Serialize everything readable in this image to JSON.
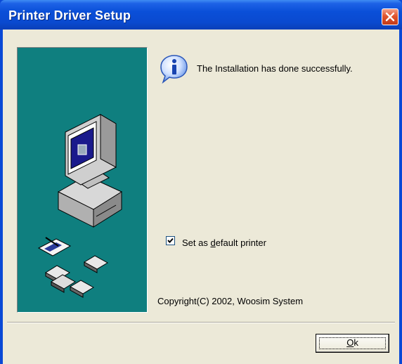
{
  "window": {
    "title": "Printer Driver Setup"
  },
  "content": {
    "message": "The Installation has done successfully.",
    "checkbox": {
      "label_prefix": "Set as ",
      "label_accel": "d",
      "label_suffix": "efault printer",
      "checked": true
    },
    "copyright": "Copyright(C) 2002, Woosim System"
  },
  "buttons": {
    "ok_accel": "O",
    "ok_rest": "k"
  },
  "icons": {
    "info": "info-icon",
    "close": "close-icon",
    "checkmark": "checkmark-icon"
  },
  "colors": {
    "title_bar": "#0a4ad0",
    "dialog_bg": "#ece9d8",
    "art_panel": "#0f7f7f",
    "close_button": "#e0552e"
  }
}
